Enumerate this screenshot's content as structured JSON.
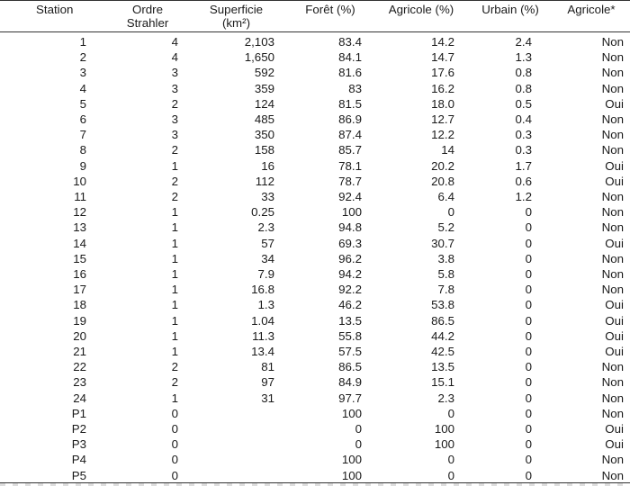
{
  "table": {
    "headers": [
      {
        "line1": "Station",
        "line2": ""
      },
      {
        "line1": "Ordre",
        "line2": "Strahler"
      },
      {
        "line1": "Superficie",
        "line2": "(km²)"
      },
      {
        "line1": "Forêt (%)",
        "line2": ""
      },
      {
        "line1": "Agricole (%)",
        "line2": ""
      },
      {
        "line1": "Urbain (%)",
        "line2": ""
      },
      {
        "line1": "Agricole*",
        "line2": ""
      }
    ],
    "rows": [
      [
        "1",
        "4",
        "2,103",
        "83.4",
        "14.2",
        "2.4",
        "Non"
      ],
      [
        "2",
        "4",
        "1,650",
        "84.1",
        "14.7",
        "1.3",
        "Non"
      ],
      [
        "3",
        "3",
        "592",
        "81.6",
        "17.6",
        "0.8",
        "Non"
      ],
      [
        "4",
        "3",
        "359",
        "83",
        "16.2",
        "0.8",
        "Non"
      ],
      [
        "5",
        "2",
        "124",
        "81.5",
        "18.0",
        "0.5",
        "Oui"
      ],
      [
        "6",
        "3",
        "485",
        "86.9",
        "12.7",
        "0.4",
        "Non"
      ],
      [
        "7",
        "3",
        "350",
        "87.4",
        "12.2",
        "0.3",
        "Non"
      ],
      [
        "8",
        "2",
        "158",
        "85.7",
        "14",
        "0.3",
        "Non"
      ],
      [
        "9",
        "1",
        "16",
        "78.1",
        "20.2",
        "1.7",
        "Oui"
      ],
      [
        "10",
        "2",
        "112",
        "78.7",
        "20.8",
        "0.6",
        "Oui"
      ],
      [
        "11",
        "2",
        "33",
        "92.4",
        "6.4",
        "1.2",
        "Non"
      ],
      [
        "12",
        "1",
        "0.25",
        "100",
        "0",
        "0",
        "Non"
      ],
      [
        "13",
        "1",
        "2.3",
        "94.8",
        "5.2",
        "0",
        "Non"
      ],
      [
        "14",
        "1",
        "57",
        "69.3",
        "30.7",
        "0",
        "Oui"
      ],
      [
        "15",
        "1",
        "34",
        "96.2",
        "3.8",
        "0",
        "Non"
      ],
      [
        "16",
        "1",
        "7.9",
        "94.2",
        "5.8",
        "0",
        "Non"
      ],
      [
        "17",
        "1",
        "16.8",
        "92.2",
        "7.8",
        "0",
        "Non"
      ],
      [
        "18",
        "1",
        "1.3",
        "46.2",
        "53.8",
        "0",
        "Oui"
      ],
      [
        "19",
        "1",
        "1.04",
        "13.5",
        "86.5",
        "0",
        "Oui"
      ],
      [
        "20",
        "1",
        "11.3",
        "55.8",
        "44.2",
        "0",
        "Oui"
      ],
      [
        "21",
        "1",
        "13.4",
        "57.5",
        "42.5",
        "0",
        "Oui"
      ],
      [
        "22",
        "2",
        "81",
        "86.5",
        "13.5",
        "0",
        "Non"
      ],
      [
        "23",
        "2",
        "97",
        "84.9",
        "15.1",
        "0",
        "Non"
      ],
      [
        "24",
        "1",
        "31",
        "97.7",
        "2.3",
        "0",
        "Non"
      ],
      [
        "P1",
        "0",
        "",
        "100",
        "0",
        "0",
        "Non"
      ],
      [
        "P2",
        "0",
        "",
        "0",
        "100",
        "0",
        "Oui"
      ],
      [
        "P3",
        "0",
        "",
        "0",
        "100",
        "0",
        "Oui"
      ],
      [
        "P4",
        "0",
        "",
        "100",
        "0",
        "0",
        "Non"
      ],
      [
        "P5",
        "0",
        "",
        "100",
        "0",
        "0",
        "Non"
      ]
    ]
  }
}
